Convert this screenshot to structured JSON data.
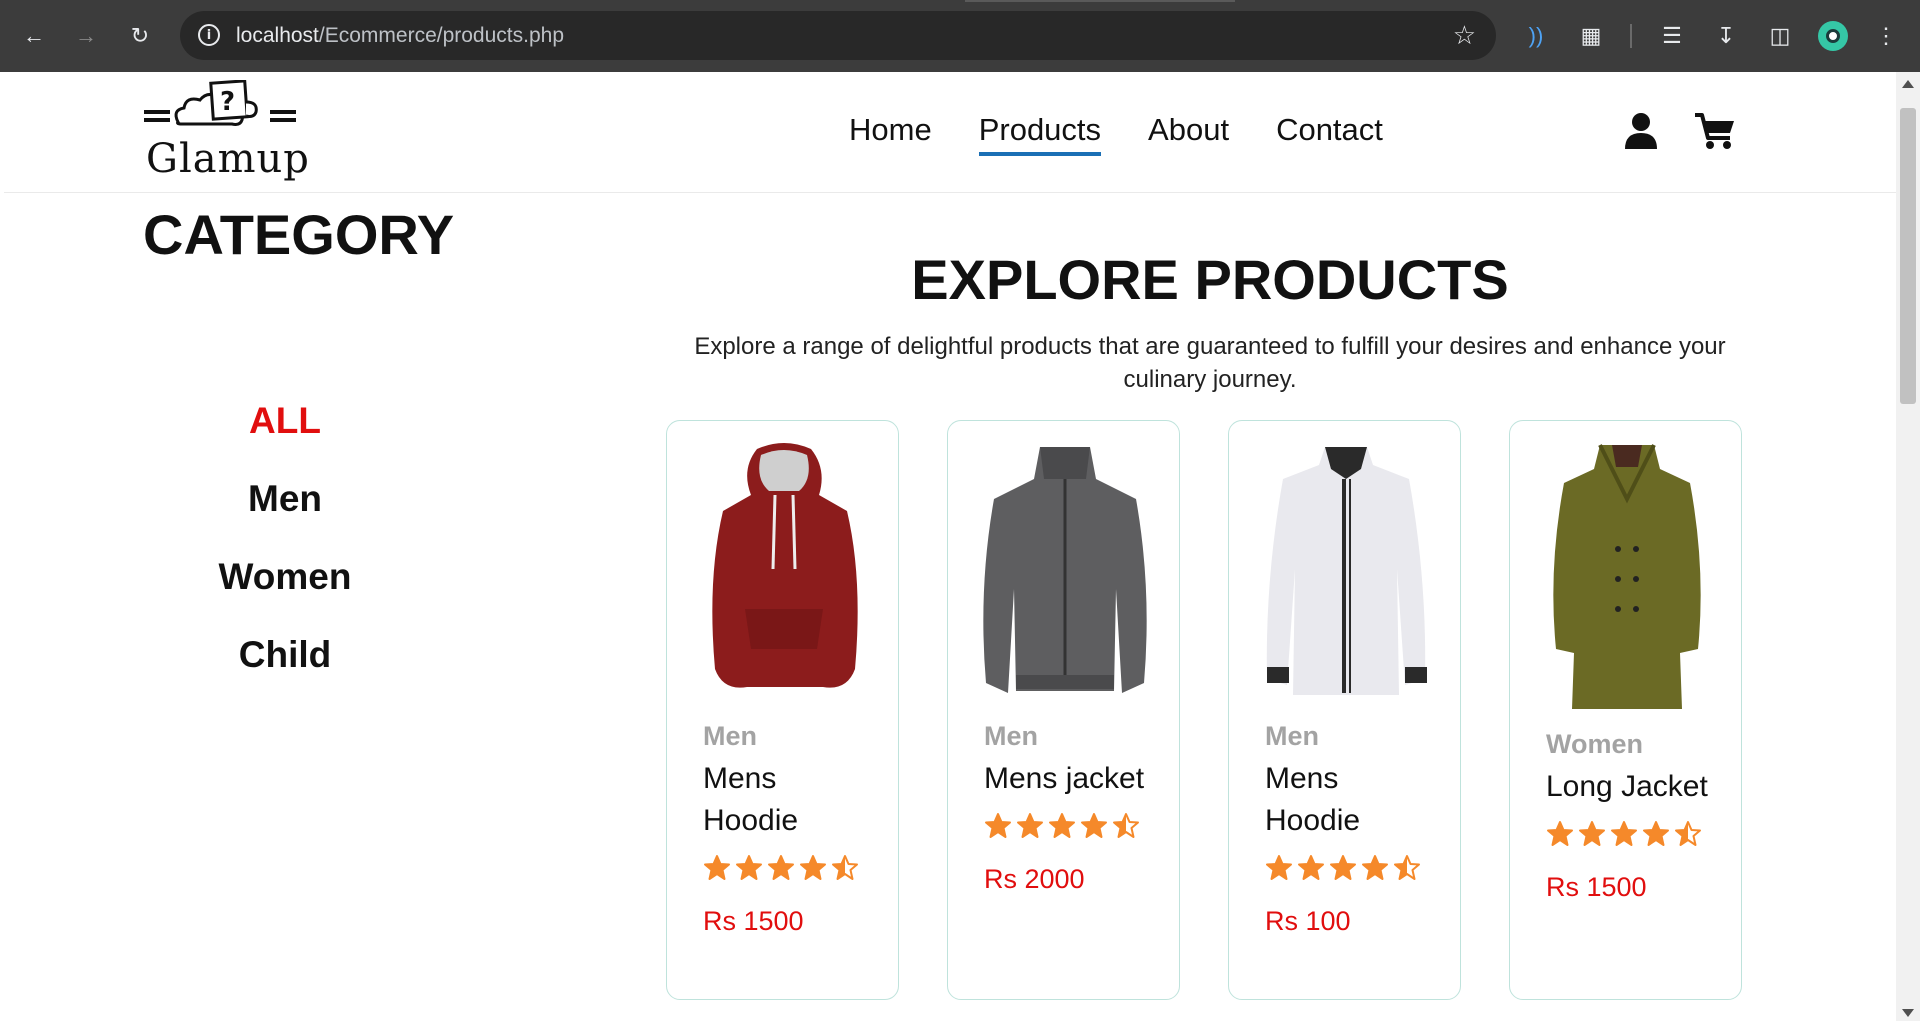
{
  "browser": {
    "url_host": "localhost",
    "url_path": "/Ecommerce/products.php"
  },
  "site": {
    "logo_text": "Glamup",
    "nav": [
      {
        "label": "Home"
      },
      {
        "label": "Products",
        "active": true
      },
      {
        "label": "About"
      },
      {
        "label": "Contact"
      }
    ]
  },
  "category": {
    "title": "CATEGORY",
    "items": [
      {
        "label": "ALL",
        "active": true
      },
      {
        "label": "Men"
      },
      {
        "label": "Women"
      },
      {
        "label": "Child"
      }
    ]
  },
  "explore": {
    "title": "EXPLORE PRODUCTS",
    "description": "Explore a range of delightful products that are guaranteed to fulfill your desires and enhance your culinary journey."
  },
  "products": [
    {
      "category": "Men",
      "name": "Mens Hoodie",
      "rating": 4.5,
      "price": "Rs 1500",
      "image": "red-hoodie"
    },
    {
      "category": "Men",
      "name": "Mens jacket",
      "rating": 4.5,
      "price": "Rs 2000",
      "image": "grey-jacket"
    },
    {
      "category": "Men",
      "name": "Mens Hoodie",
      "rating": 4.5,
      "price": "Rs 100",
      "image": "white-shirt"
    },
    {
      "category": "Women",
      "name": "Long Jacket",
      "rating": 4.5,
      "price": "Rs 1500",
      "image": "olive-coat"
    }
  ],
  "colors": {
    "accent_red": "#e10e0e",
    "star_orange": "#f5892a",
    "nav_underline": "#1a6fb5",
    "card_border": "#bfe3dc"
  }
}
